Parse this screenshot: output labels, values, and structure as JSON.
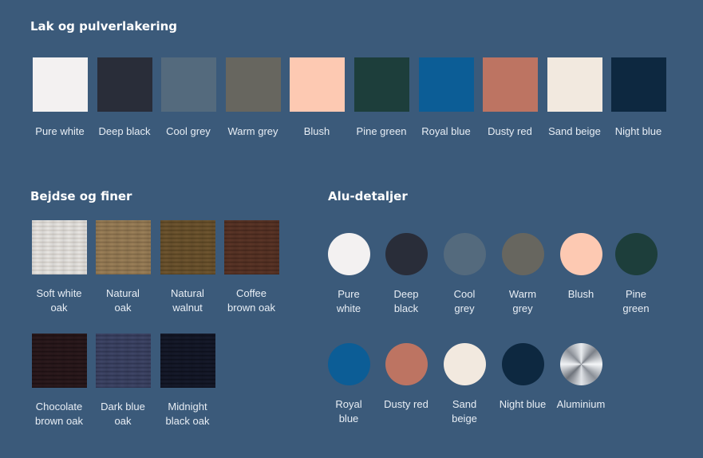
{
  "lak": {
    "title": "Lak og pulverlakering",
    "items": [
      {
        "label": "Pure white",
        "color": "#f3f1f1"
      },
      {
        "label": "Deep black",
        "color": "#292d39"
      },
      {
        "label": "Cool grey",
        "color": "#546a7d"
      },
      {
        "label": "Warm grey",
        "color": "#67665f"
      },
      {
        "label": "Blush",
        "color": "#fdc9b2"
      },
      {
        "label": "Pine green",
        "color": "#1d3e3b"
      },
      {
        "label": "Royal blue",
        "color": "#0c5d96"
      },
      {
        "label": "Dusty red",
        "color": "#bd7462"
      },
      {
        "label": "Sand beige",
        "color": "#f2e9df"
      },
      {
        "label": "Night blue",
        "color": "#0d2840"
      }
    ]
  },
  "bejdse": {
    "title": "Bejdse og finer",
    "items": [
      {
        "line1": "Soft white",
        "line2": "oak",
        "color": "#e7e5e2",
        "grain": "#cfcac4"
      },
      {
        "line1": "Natural",
        "line2": "oak",
        "color": "#9a7f58",
        "grain": "#7e6645"
      },
      {
        "line1": "Natural",
        "line2": "walnut",
        "color": "#6e5530",
        "grain": "#54401f"
      },
      {
        "line1": "Coffee",
        "line2": "brown oak",
        "color": "#5a3527",
        "grain": "#43251a"
      },
      {
        "line1": "Chocolate",
        "line2": "brown oak",
        "color": "#2b1a1d",
        "grain": "#1b0f12"
      },
      {
        "line1": "Dark blue",
        "line2": "oak",
        "color": "#3e4566",
        "grain": "#2d3350"
      },
      {
        "line1": "Midnight",
        "line2": "black oak",
        "color": "#161a2a",
        "grain": "#0c0f1b"
      }
    ]
  },
  "alu": {
    "title": "Alu-detaljer",
    "items": [
      {
        "line1": "Pure",
        "line2": "white",
        "color": "#f3f1f1"
      },
      {
        "line1": "Deep",
        "line2": "black",
        "color": "#292d39"
      },
      {
        "line1": "Cool",
        "line2": "grey",
        "color": "#546a7d"
      },
      {
        "line1": "Warm",
        "line2": "grey",
        "color": "#67665f"
      },
      {
        "line1": "Blush",
        "line2": "",
        "color": "#fdc9b2"
      },
      {
        "line1": "Pine",
        "line2": "green",
        "color": "#1d3e3b"
      },
      {
        "line1": "Royal",
        "line2": "blue",
        "color": "#0c5d96"
      },
      {
        "line1": "Dusty red",
        "line2": "",
        "color": "#bd7462"
      },
      {
        "line1": "Sand",
        "line2": "beige",
        "color": "#f2e9df"
      },
      {
        "line1": "Night blue",
        "line2": "",
        "color": "#0d2840"
      },
      {
        "line1": "Aluminium",
        "line2": "",
        "color": "#b8bcc2",
        "metallic": true
      }
    ]
  }
}
